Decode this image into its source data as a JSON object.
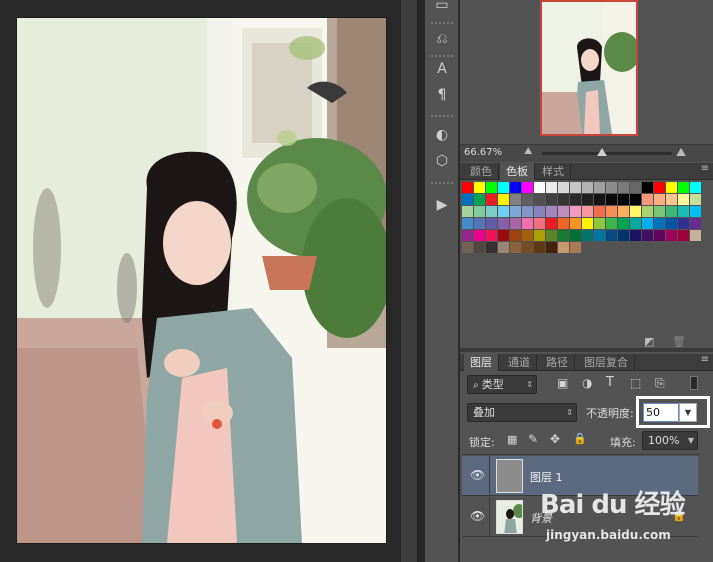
{
  "navigator": {
    "zoom": "66.67%"
  },
  "swatches_panel": {
    "tabs": [
      "颜色",
      "色板",
      "样式"
    ],
    "active_tab": "色板",
    "rows": [
      [
        "#ff0000",
        "#ffff00",
        "#00ff00",
        "#00ffff",
        "#0000ff",
        "#ff00ff",
        "#ffffff",
        "#ececec",
        "#d9d9d9",
        "#c6c6c6",
        "#b3b3b3",
        "#a0a0a0",
        "#8d8d8d",
        "#7a7a7a",
        "#676767",
        "#000000",
        "#ff0000",
        "#ffff00",
        "#00ff00",
        "#00ffff"
      ],
      [
        "#0070c0",
        "#00a651",
        "#ed1c24",
        "#fff200",
        "#808080",
        "#606060",
        "#505050",
        "#404040",
        "#353535",
        "#2a2a2a",
        "#202020",
        "#151515",
        "#0a0a0a",
        "#050505",
        "#000000",
        "#f7977a",
        "#fbad82",
        "#fdc68c",
        "#fff799",
        "#c4df9b"
      ],
      [
        "#a3d39c",
        "#82ca9d",
        "#7bcdc8",
        "#6ecff6",
        "#7ea7d8",
        "#8493ca",
        "#8882be",
        "#a187be",
        "#bc8dbf",
        "#f49ac2",
        "#f6989d",
        "#f26c4f",
        "#f68e56",
        "#fbaf5d",
        "#fff568",
        "#acd372",
        "#7cc576",
        "#3bb878",
        "#1abbb4",
        "#00bff3"
      ],
      [
        "#438ccb",
        "#5574b9",
        "#605ca8",
        "#855fa8",
        "#a864a8",
        "#f06ea9",
        "#f26d7d",
        "#ed1c24",
        "#f26522",
        "#f7941d",
        "#fff200",
        "#8dc63f",
        "#39b54a",
        "#00a651",
        "#00a99d",
        "#00aeef",
        "#0072bc",
        "#0054a6",
        "#2e3192",
        "#662d91"
      ],
      [
        "#92278f",
        "#ec008c",
        "#ed145b",
        "#9e0b0f",
        "#a0410d",
        "#a36209",
        "#aba000",
        "#598527",
        "#1a7b30",
        "#007236",
        "#00746b",
        "#0076a3",
        "#004b80",
        "#003471",
        "#1b1464",
        "#440e62",
        "#630460",
        "#9e005d",
        "#9e0039",
        "#c7b299"
      ],
      [
        "#736357",
        "#534741",
        "#362f2d",
        "#998675",
        "#8c6239",
        "#754c24",
        "#603913",
        "#42210b",
        "#c69c6d",
        "#a67c52"
      ]
    ]
  },
  "layers_panel": {
    "tabs": [
      "图层",
      "通道",
      "路径",
      "图层复合"
    ],
    "active_tab": "图层",
    "filter_kind": "类型",
    "blend_mode": "叠加",
    "opacity_label": "不透明度:",
    "opacity_value": "50",
    "lock_label": "锁定:",
    "fill_label": "填充:",
    "fill_value": "100%",
    "layers": [
      {
        "name": "图层 1",
        "selected": true
      },
      {
        "name": "背景",
        "selected": false
      }
    ]
  },
  "watermark": {
    "brand": "Bai du 经验",
    "url": "jingyan.baidu.com"
  },
  "colors": {
    "highlight_box": "#ffffff",
    "panel_bg": "#535353",
    "selected_layer": "#5b6a7f",
    "nav_frame": "#c8453c"
  }
}
